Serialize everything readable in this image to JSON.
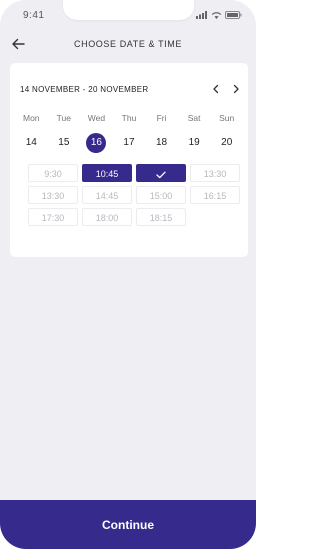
{
  "status": {
    "time": "9:41"
  },
  "header": {
    "title": "CHOOSE DATE & TIME",
    "back_icon": "arrow-left-icon"
  },
  "calendar": {
    "range": "14 NOVEMBER - 20 NOVEMBER",
    "prev_icon": "chevron-left-icon",
    "next_icon": "chevron-right-icon",
    "days": [
      {
        "name": "Mon",
        "date": "14"
      },
      {
        "name": "Tue",
        "date": "15"
      },
      {
        "name": "Wed",
        "date": "16",
        "selected": true
      },
      {
        "name": "Thu",
        "date": "17"
      },
      {
        "name": "Fri",
        "date": "18"
      },
      {
        "name": "Sat",
        "date": "19"
      },
      {
        "name": "Sun",
        "date": "20"
      }
    ]
  },
  "slots": [
    {
      "label": "9:30",
      "state": "available"
    },
    {
      "label": "10:45",
      "state": "selected"
    },
    {
      "label": "",
      "state": "checked",
      "icon": "check-icon"
    },
    {
      "label": "13:30",
      "state": "available"
    },
    {
      "label": "13:30",
      "state": "available"
    },
    {
      "label": "14:45",
      "state": "available"
    },
    {
      "label": "15:00",
      "state": "available"
    },
    {
      "label": "16:15",
      "state": "available"
    },
    {
      "label": "17:30",
      "state": "available"
    },
    {
      "label": "18:00",
      "state": "available"
    },
    {
      "label": "18:15",
      "state": "available"
    }
  ],
  "footer": {
    "continue_label": "Continue"
  },
  "colors": {
    "accent": "#362a8c",
    "background": "#efeff3"
  }
}
